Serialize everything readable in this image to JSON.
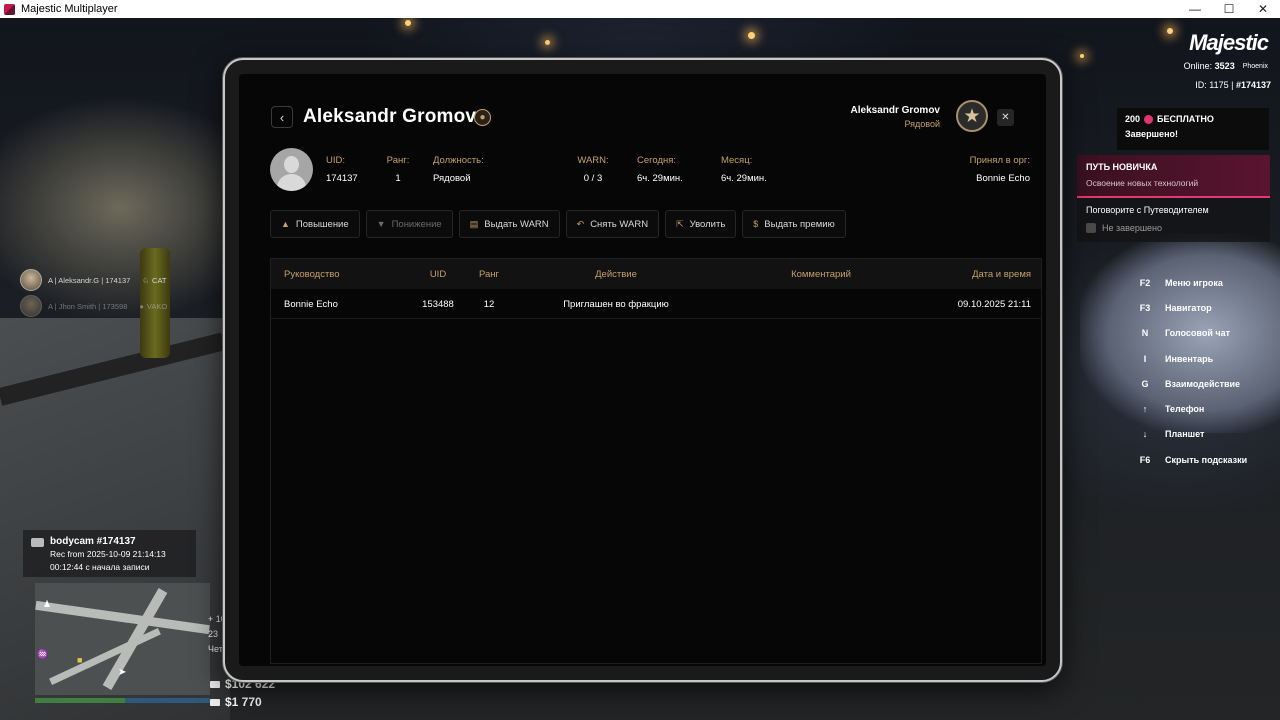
{
  "window": {
    "title": "Majestic Multiplayer",
    "controls": [
      "—",
      "☐",
      "✕"
    ]
  },
  "hud": {
    "logo": "Majestic",
    "online_label": "Online:",
    "online_count": "3523",
    "server": "Phoenix",
    "id_label": "ID: 1175 |",
    "id_value": "#174137",
    "promo": {
      "amount": "200",
      "label": "БЕСПЛАТНО",
      "status": "Завершено!"
    },
    "quest": {
      "title": "ПУТЬ НОВИЧКА",
      "subtitle": "Освоение новых технологий",
      "task": "Поговорите с Путеводителем",
      "status": "Не завершено"
    },
    "hints": [
      {
        "key": "F2",
        "label": "Меню игрока"
      },
      {
        "key": "F3",
        "label": "Навигатор"
      },
      {
        "key": "N",
        "label": "Голосовой чат"
      },
      {
        "key": "I",
        "label": "Инвентарь"
      },
      {
        "key": "G",
        "label": "Взаимодействие"
      },
      {
        "key": "↑",
        "label": "Телефон"
      },
      {
        "key": "↓",
        "label": "Планшет"
      },
      {
        "key": "F6",
        "label": "Скрыть подсказки"
      }
    ],
    "players": [
      {
        "text": "A | Aleksandr.G | 174137",
        "tag": "CAT"
      },
      {
        "text": "A | Jhon Smith | 173598",
        "tag": "VAKO"
      }
    ],
    "bodycam": {
      "title": "bodycam #174137",
      "rec": "Rec from 2025-10-09 21:14:13",
      "elapsed": "00:12:44 с начала записи"
    },
    "side_info": [
      "+ 10",
      "23",
      "Чет"
    ],
    "cash": "$102 622",
    "bank": "$1 770"
  },
  "profile": {
    "name": "Aleksandr Gromov",
    "viewer_name": "Aleksandr Gromov",
    "viewer_rank": "Рядовой",
    "uid_label": "UID:",
    "uid": "174137",
    "rank_label": "Ранг:",
    "rank": "1",
    "position_label": "Должность:",
    "position": "Рядовой",
    "warn_label": "WARN:",
    "warn": "0 / 3",
    "today_label": "Сегодня:",
    "today": "6ч. 29мин.",
    "month_label": "Месяц:",
    "month": "6ч. 29мин.",
    "accepted_label": "Принял в орг:",
    "accepted_by": "Bonnie Echo"
  },
  "actions": [
    {
      "label": "Повышение",
      "icon": "chevron-up-icon",
      "enabled": true
    },
    {
      "label": "Понижение",
      "icon": "chevron-down-icon",
      "enabled": false
    },
    {
      "label": "Выдать WARN",
      "icon": "document-icon",
      "enabled": true
    },
    {
      "label": "Снять WARN",
      "icon": "undo-icon",
      "enabled": true
    },
    {
      "label": "Уволить",
      "icon": "person-leave-icon",
      "enabled": true
    },
    {
      "label": "Выдать премию",
      "icon": "coin-icon",
      "enabled": true
    }
  ],
  "log": {
    "columns": [
      "Руководство",
      "UID",
      "Ранг",
      "Действие",
      "Комментарий",
      "Дата и время"
    ],
    "rows": [
      {
        "boss": "Bonnie Echo",
        "uid": "153488",
        "rank": "12",
        "action": "Приглашен во фракцию",
        "comment": "",
        "datetime": "09.10.2025 21:11"
      }
    ]
  }
}
